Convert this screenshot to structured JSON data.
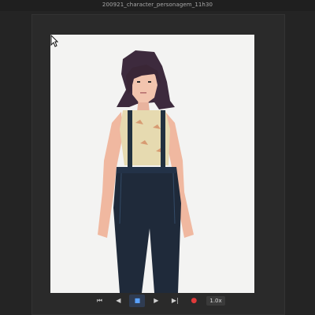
{
  "window": {
    "title": "200921_character_personagem_11h30"
  },
  "playback": {
    "controls": [
      {
        "name": "go-to-start-button",
        "icon": "⏮"
      },
      {
        "name": "step-back-button",
        "icon": "◀"
      },
      {
        "name": "stop-button",
        "icon": "■",
        "active": true
      },
      {
        "name": "play-button",
        "icon": "▶"
      },
      {
        "name": "step-forward-button",
        "icon": "▶|"
      },
      {
        "name": "record-button",
        "icon": "●"
      }
    ],
    "speed": "1.0x"
  },
  "colors": {
    "background": "#242424",
    "canvas": "#f3f3f2",
    "accent": "#5aa2ff",
    "record": "#e03a3a"
  }
}
